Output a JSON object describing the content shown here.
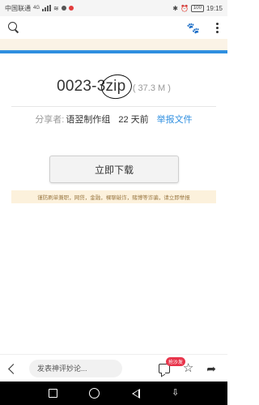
{
  "status_bar": {
    "carrier": "中国联通",
    "network": "4G",
    "battery": "100",
    "time": "19:15"
  },
  "toolbar": {
    "icons": [
      "search-icon",
      "paw-icon",
      "more-icon"
    ]
  },
  "file": {
    "name_prefix": "0023-3",
    "extension": "zip",
    "size": "( 37.3 M )"
  },
  "meta": {
    "sharer_label": "分享者:",
    "uploader": "语翌制作组",
    "time_ago": "22 天前",
    "report_link": "举报文件"
  },
  "download_button": "立即下载",
  "warning": "谨防刷单兼职，网贷，金融，裸聊敲诈，赌博等诈骗，请立即举报",
  "bottom_bar": {
    "comment_placeholder": "发表神评妙论...",
    "sofa_badge": "抢沙发"
  },
  "colors": {
    "accent": "#2f8fe0",
    "warning_bg": "#fcf1dc",
    "badge": "#e8334a"
  }
}
